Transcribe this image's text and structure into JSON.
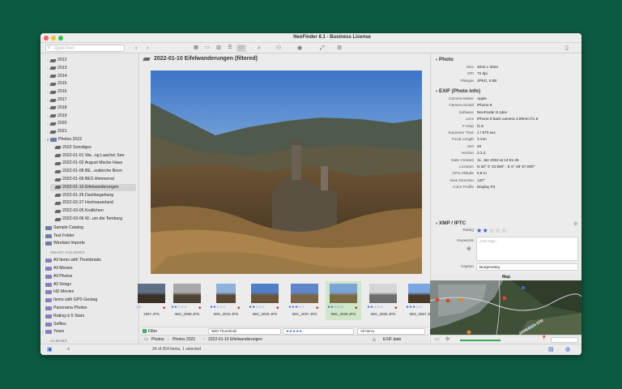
{
  "window": {
    "title": "NeoFinder 8.1 - Business License"
  },
  "toolbar": {
    "search_placeholder": "Quick Find"
  },
  "sidebar": {
    "years": [
      "2012",
      "2013",
      "2014",
      "2015",
      "2016",
      "2017",
      "2018",
      "2019",
      "2020",
      "2021"
    ],
    "photos_folder": "Photos 2022",
    "photo_items": [
      "2022 Sonstiges",
      "2022-01-01 Wa...ng Laacher See",
      "2022-01-02 August Macke Haus",
      "2022-01-08 BE...eutkirche Bonn",
      "2022-01-09 BES Himmerod",
      "2022-01-10 Eifelwanderungen",
      "2022-01-26 Dachbegehung",
      "2022-02-27 Hochsauerland",
      "2022-03-05 Knällchen",
      "2022-03-06 W...um die Tomburg"
    ],
    "other_items": [
      "Sample Catalog",
      "Test Folder",
      "Wirelaist Importe"
    ],
    "smart_label": "SMART FOLDERS",
    "smart_items": [
      "All Items with Thumbnails",
      "All Movies",
      "All Photos",
      "All Songs",
      "HD Movies",
      "Items with GPS Geotag",
      "Panorama Photos",
      "Rating is 5 Stars",
      "Selfies",
      "Years"
    ],
    "albums_label": "ALBUMS"
  },
  "center": {
    "folder_title": "2022-01-10 Eifelwanderungen (filtered)",
    "thumbnails": [
      {
        "name": "1997.JPG",
        "stars": "☆☆"
      },
      {
        "name": "IMG_2998.JPG",
        "stars": "★★☆☆☆"
      },
      {
        "name": "IMG_3023.JPG",
        "stars": "★★☆☆☆"
      },
      {
        "name": "IMG_3029.JPG",
        "stars": "★★☆☆☆"
      },
      {
        "name": "IMG_3037.JPG",
        "stars": "★★★☆☆"
      },
      {
        "name": "IMG_3038.JPG",
        "stars": "★★☆☆☆"
      },
      {
        "name": "IMG_3055.JPG",
        "stars": "★★☆☆☆"
      },
      {
        "name": "IMG_3057.JPG",
        "stars": "★★★☆☆"
      }
    ],
    "filter": {
      "label": "Filter",
      "kind_value": "With Thumbnail",
      "rating_value": "★★★★★",
      "items_value": "All Items"
    },
    "pathbar": {
      "segments": [
        "Photos",
        "Photos 2022",
        "2022-01-10 Eifelwanderungen"
      ],
      "sort": "EXIF date"
    }
  },
  "inspector": {
    "photo": {
      "header": "Photo",
      "rows": [
        {
          "k": "Size",
          "v": "4032 x 3024"
        },
        {
          "k": "DPI",
          "v": "72 dpi"
        },
        {
          "k": "Filetype",
          "v": "JPEG, 8 Bit"
        }
      ]
    },
    "exif": {
      "header": "EXIF (Photo info)",
      "rows": [
        {
          "k": "Camera Maker",
          "v": "Apple"
        },
        {
          "k": "Camera Model",
          "v": "iPhone 8"
        },
        {
          "k": "Software",
          "v": "NeoFinder 8.1dev"
        },
        {
          "k": "Lens",
          "v": "iPhone 8 back camera 3.99mm f/1.8"
        },
        {
          "k": "F-Stop",
          "v": "f1.8"
        },
        {
          "k": "Exposure Time",
          "v": "1 / 873 sec"
        },
        {
          "k": "Focal Length",
          "v": "3 mm"
        },
        {
          "k": "ISO",
          "v": "20"
        },
        {
          "k": "Version",
          "v": "2.3.2"
        },
        {
          "k": "Date Created",
          "v": "11. Jan 2022 at 14:01:45"
        },
        {
          "k": "Location",
          "v": "N 50° 5' 33.590\" , E 6° 48' 57.000\""
        },
        {
          "k": "GPS Altitude",
          "v": "5.8 m"
        },
        {
          "k": "View Direction",
          "v": "120°"
        },
        {
          "k": "Color Profile",
          "v": "Display P3"
        }
      ]
    },
    "xmp": {
      "header": "XMP / IPTC",
      "rating_label": "Rating",
      "rating_on": "★★",
      "rating_off": "☆☆☆",
      "keywords_label": "Keywords",
      "keywords_placeholder": "Add Tags...",
      "caption_label": "Caption",
      "caption_value": "Burgensteig"
    }
  },
  "map": {
    "header": "Map",
    "street_label": "SCHEIDEN STR"
  },
  "status": {
    "text": "24 of 254 items, 1 selected"
  },
  "colors": {
    "accent": "#2a5bd7",
    "selection_green": "#cfe7c8"
  }
}
